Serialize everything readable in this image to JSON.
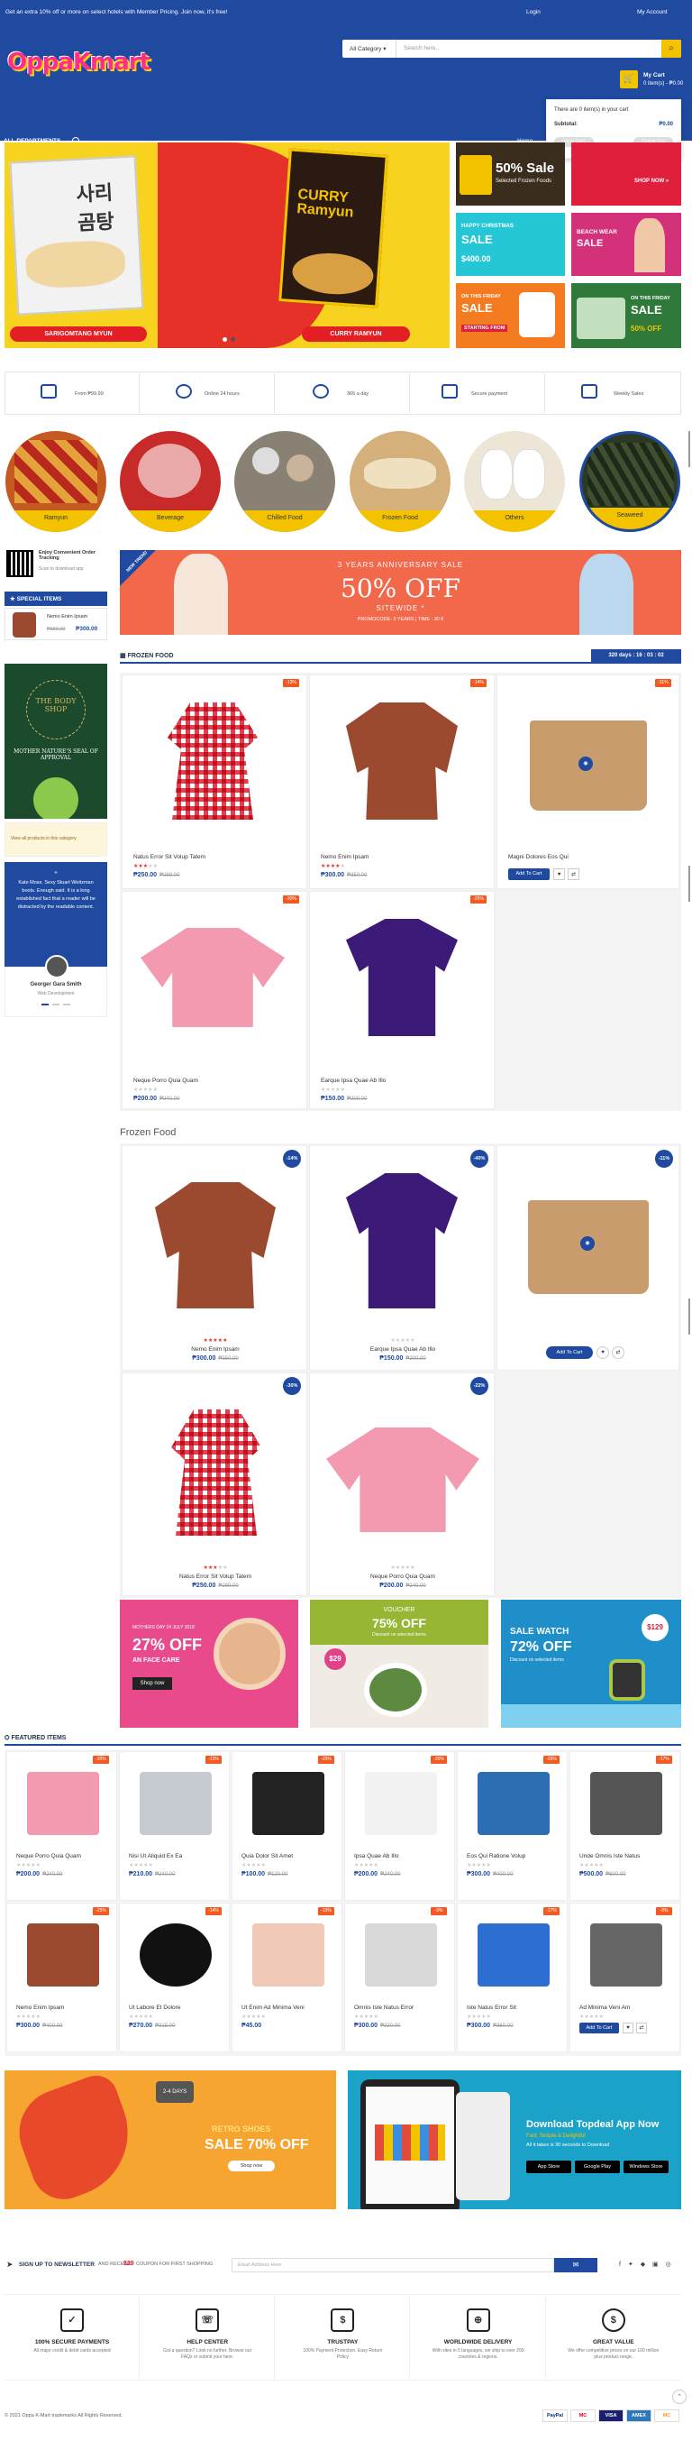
{
  "topbar": {
    "promo": "Get an extra 10% off or more on select hotels with Member Pricing. Join now, it's free!",
    "login": "Login",
    "account": "My Account"
  },
  "header": {
    "logo": "OppaKmart",
    "search_category": "All Category",
    "search_placeholder": "Search here...",
    "cart_title": "My Cart",
    "cart_summary": "0 item(s) - ₱0.00"
  },
  "nav": {
    "departments": "ALL DEPARTMENTS",
    "home": "Home"
  },
  "cart_popup": {
    "empty": "There are 0 item(s) in your cart",
    "subtotal_label": "Subtotal:",
    "subtotal": "₱0.00",
    "view_cart": "View Cart",
    "checkout": "Check Out"
  },
  "slider": {
    "left_label": "SARIGOMTANG MYUN",
    "right_label": "CURRY RAMYUN",
    "pack_left": "사리곰탕",
    "pack_right": "CURRY Ramyun"
  },
  "banners": {
    "b1_title": "50% Sale",
    "b1_sub": "Selected Frozen Foods",
    "b2_title": "SHOP NOW »",
    "b3_title": "HAPPY CHRISTMAS",
    "b3_sale": "SALE",
    "b3_price": "$400.00",
    "b4_title": "BEACH WEAR",
    "b4_sale": "SALE",
    "b5_title": "ON THIS FRIDAY",
    "b5_sale": "SALE",
    "b5_price": "STARTING FROM",
    "b6_title": "ON THIS FRIDAY",
    "b6_sale": "SALE",
    "b6_off": "50% OFF"
  },
  "features": [
    {
      "label": "From ₱99.99"
    },
    {
      "label": "Online 24 hours"
    },
    {
      "label": "365 a day"
    },
    {
      "label": "Secure payment"
    },
    {
      "label": "Weekly Sales"
    }
  ],
  "categories": [
    "Ramyun",
    "Beverage",
    "Chilled Food",
    "Frozen Food",
    "Others",
    "Seaweed"
  ],
  "sidebar": {
    "qr_title": "Enjoy Convenient Order Tracking",
    "qr_sub": "Scan to download app",
    "special_title": "SPECIAL ITEMS",
    "special_item": {
      "name": "Nemo Enim Ipsam",
      "old": "₱350.00",
      "price": "₱300.00"
    },
    "bodyshop_title": "THE BODY SHOP",
    "bodyshop_sub": "MOTHER NATURE'S SEAL OF APPROVAL",
    "no_products": "View all products in this category",
    "testimonial": "Kate Moss. Sexy Stuart Weitzman boots. Enough said. It is a long established fact that a reader will be distracted by the readable content.",
    "testimonial_name": "Georger Gara Smith",
    "testimonial_role": "Web Development"
  },
  "anniversary": {
    "line1": "3 YEARS ANNIVERSARY SALE",
    "big": "50% OFF",
    "line2": "SITEWIDE *",
    "line3": "PROMOCODE: 3 YEARS | TIME : 30 6",
    "ribbon": "NEW TREND"
  },
  "frozen1": {
    "title": "FROZEN FOOD",
    "countdown": "320 days : 16 : 03 : 02",
    "products": [
      {
        "name": "Natus Error Sit Volup Tatem",
        "price": "₱250.00",
        "old": "₱289.00",
        "badge": "-13%",
        "stars": 3
      },
      {
        "name": "Nemo Enim Ipsam",
        "price": "₱300.00",
        "old": "₱350.00",
        "badge": "-14%",
        "stars": 4
      },
      {
        "name": "Magni Dolores Eos Qui",
        "price": "",
        "old": "",
        "badge": "-11%",
        "stars": 0,
        "add": "Add To Cart"
      },
      {
        "name": "Neque Porro Quia Quam",
        "price": "₱200.00",
        "old": "₱240.00",
        "badge": "-20%",
        "stars": 0
      },
      {
        "name": "Earque Ipsa Quae Ab Illo",
        "price": "₱150.00",
        "old": "₱200.00",
        "badge": "-25%",
        "stars": 0
      }
    ]
  },
  "frozen2": {
    "title": "Frozen Food",
    "products": [
      {
        "name": "Nemo Enim Ipsam",
        "price": "₱300.00",
        "old": "₱350.00",
        "badge": "-14%",
        "stars": 5
      },
      {
        "name": "Earque Ipsa Quae Ab Illo",
        "price": "₱150.00",
        "old": "₱200.00",
        "badge": "-40%",
        "stars": 0
      },
      {
        "name": "",
        "price": "",
        "old": "",
        "badge": "-11%",
        "stars": 0,
        "add": "Add To Cart"
      },
      {
        "name": "Natus Error Sit Volup Tatem",
        "price": "₱250.00",
        "old": "₱289.00",
        "badge": "-30%",
        "stars": 3
      },
      {
        "name": "Neque Porro Quia Quam",
        "price": "₱200.00",
        "old": "₱240.00",
        "badge": "-22%",
        "stars": 0
      }
    ]
  },
  "promo3": {
    "p1_small": "MOTHERS DAY 24 JULY 2018",
    "p1_big": "27% OFF",
    "p1_sub": "AN FACE CARE",
    "p1_btn": "Shop now",
    "p2_small": "VOUCHER",
    "p2_big": "75% OFF",
    "p2_sub": "Discount on selected items",
    "p2_price": "$29",
    "p3_small": "SALE WATCH",
    "p3_big": "72% OFF",
    "p3_sub": "Discount on selected items",
    "p3_price": "$129"
  },
  "featured": {
    "title": "FEATURED ITEMS",
    "products": [
      {
        "name": "Neque Porro Quia Quam",
        "price": "₱200.00",
        "old": "₱240.00",
        "badge": "-20%"
      },
      {
        "name": "Nisi Ut Aliquid Ex Ea",
        "price": "₱210.00",
        "old": "₱240.00",
        "badge": "-13%"
      },
      {
        "name": "Quia Dolor Sit Amet",
        "price": "₱100.00",
        "old": "₱120.00",
        "badge": "-20%"
      },
      {
        "name": "Ipsa Quae Ab Illo",
        "price": "₱200.00",
        "old": "₱240.00",
        "badge": "-20%"
      },
      {
        "name": "Eos Qui Ratione Volup",
        "price": "₱300.00",
        "old": "₱400.00",
        "badge": "-25%"
      },
      {
        "name": "Unde Omnis Iste Natus",
        "price": "₱500.00",
        "old": "₱600.00",
        "badge": "-17%"
      },
      {
        "name": "Nemo Enim Ipsam",
        "price": "₱300.00",
        "old": "₱400.00",
        "badge": "-25%"
      },
      {
        "name": "Ut Labore Et Dolore",
        "price": "₱270.00",
        "old": "₱315.00",
        "badge": "-14%"
      },
      {
        "name": "Ut Enim Ad Minima Veni",
        "price": "₱45.00",
        "old": "",
        "badge": "-10%"
      },
      {
        "name": "Omnis Iste Natus Error",
        "price": "₱300.00",
        "old": "₱330.00",
        "badge": "-9%"
      },
      {
        "name": "Iste Natus Error Sit",
        "price": "₱300.00",
        "old": "₱360.00",
        "badge": "-17%"
      },
      {
        "name": "Ad Minima Veni Am",
        "price": "",
        "old": "",
        "badge": "-8%",
        "add": "Add To Cart"
      }
    ]
  },
  "retro": {
    "tag": "2-4 DAYS",
    "line1": "RETRO SHOES",
    "line2": "SALE 70% OFF",
    "btn": "Shop now"
  },
  "app": {
    "title": "Download Topdeal App Now",
    "sub1": "Fast, Simple & Delightful",
    "sub2": "All it takes is 30 seconds to Download",
    "store1": "App Store",
    "store2": "Google Play",
    "store3": "Windows Store"
  },
  "newsletter": {
    "title": "SIGN UP TO NEWSLETTER",
    "sub": "AND RECEIVE",
    "amount": "$29",
    "sub2": "COUPON FOR FIRST SHOPPING",
    "placeholder": "Email Address Here",
    "btn": "✉"
  },
  "bottom_features": [
    {
      "title": "100% SECURE PAYMENTS",
      "sub": "All major credit & debit cards accepted"
    },
    {
      "title": "HELP CENTER",
      "sub": "Got a question? Look no further. Browse our FAQs or submit your here."
    },
    {
      "title": "TRUSTPAY",
      "sub": "100% Payment Protection. Easy Return Policy"
    },
    {
      "title": "WORLDWIDE DELIVERY",
      "sub": "With sites in 5 languages, we ship to over 200 countries & regions."
    },
    {
      "title": "GREAT VALUE",
      "sub": "We offer competitive prices on our 100 million plus product range."
    }
  ],
  "footer": {
    "copyright": "© 2021 Oppa K-Mart trademarks All Rights Reserved.",
    "payments": [
      "PayPal",
      "MC",
      "VISA",
      "AMEX",
      "MC"
    ]
  },
  "colors": {
    "brand": "#1f4aa0",
    "accent": "#f4c300",
    "sale": "#f25a22"
  }
}
